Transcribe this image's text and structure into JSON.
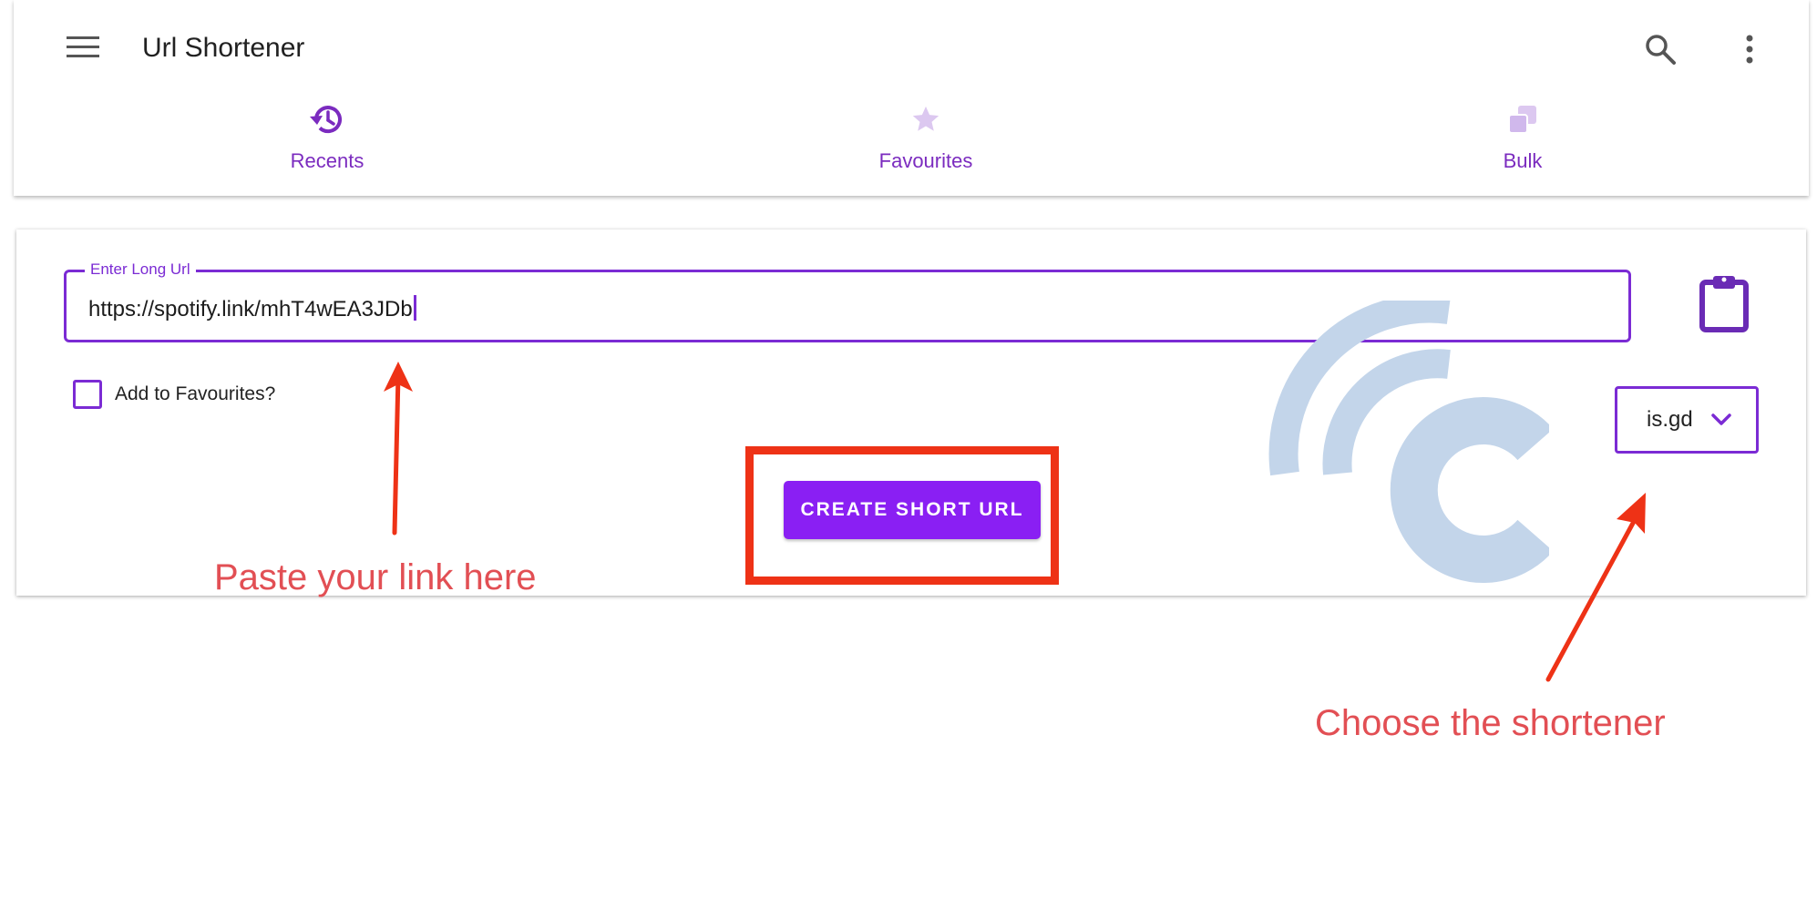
{
  "app": {
    "title": "Url Shortener"
  },
  "toolbar": {
    "menu_icon": "menu-icon",
    "search_icon": "search-icon",
    "more_icon": "more-vert-icon"
  },
  "tabs": [
    {
      "label": "Recents",
      "icon": "history-icon",
      "selected": true
    },
    {
      "label": "Favourites",
      "icon": "star-icon",
      "selected": false
    },
    {
      "label": "Bulk",
      "icon": "copies-icon",
      "selected": false
    }
  ],
  "form": {
    "url_label": "Enter Long Url",
    "url_value": "https://spotify.link/mhT4wEA3JDb",
    "clipboard_icon": "clipboard-icon",
    "favourite_label": "Add to Favourites?",
    "favourite_checked": false,
    "shortener_selected": "is.gd",
    "create_button_label": "CREATE SHORT URL"
  },
  "annotations": {
    "paste_note": "Paste your link here",
    "choose_note": "Choose the shortener"
  },
  "colors": {
    "accent": "#7b2bd4",
    "button": "#8a1ff3",
    "annotation_red": "#ee3216",
    "annotation_text": "#e24f54",
    "watermark": "#c3d5ea"
  }
}
